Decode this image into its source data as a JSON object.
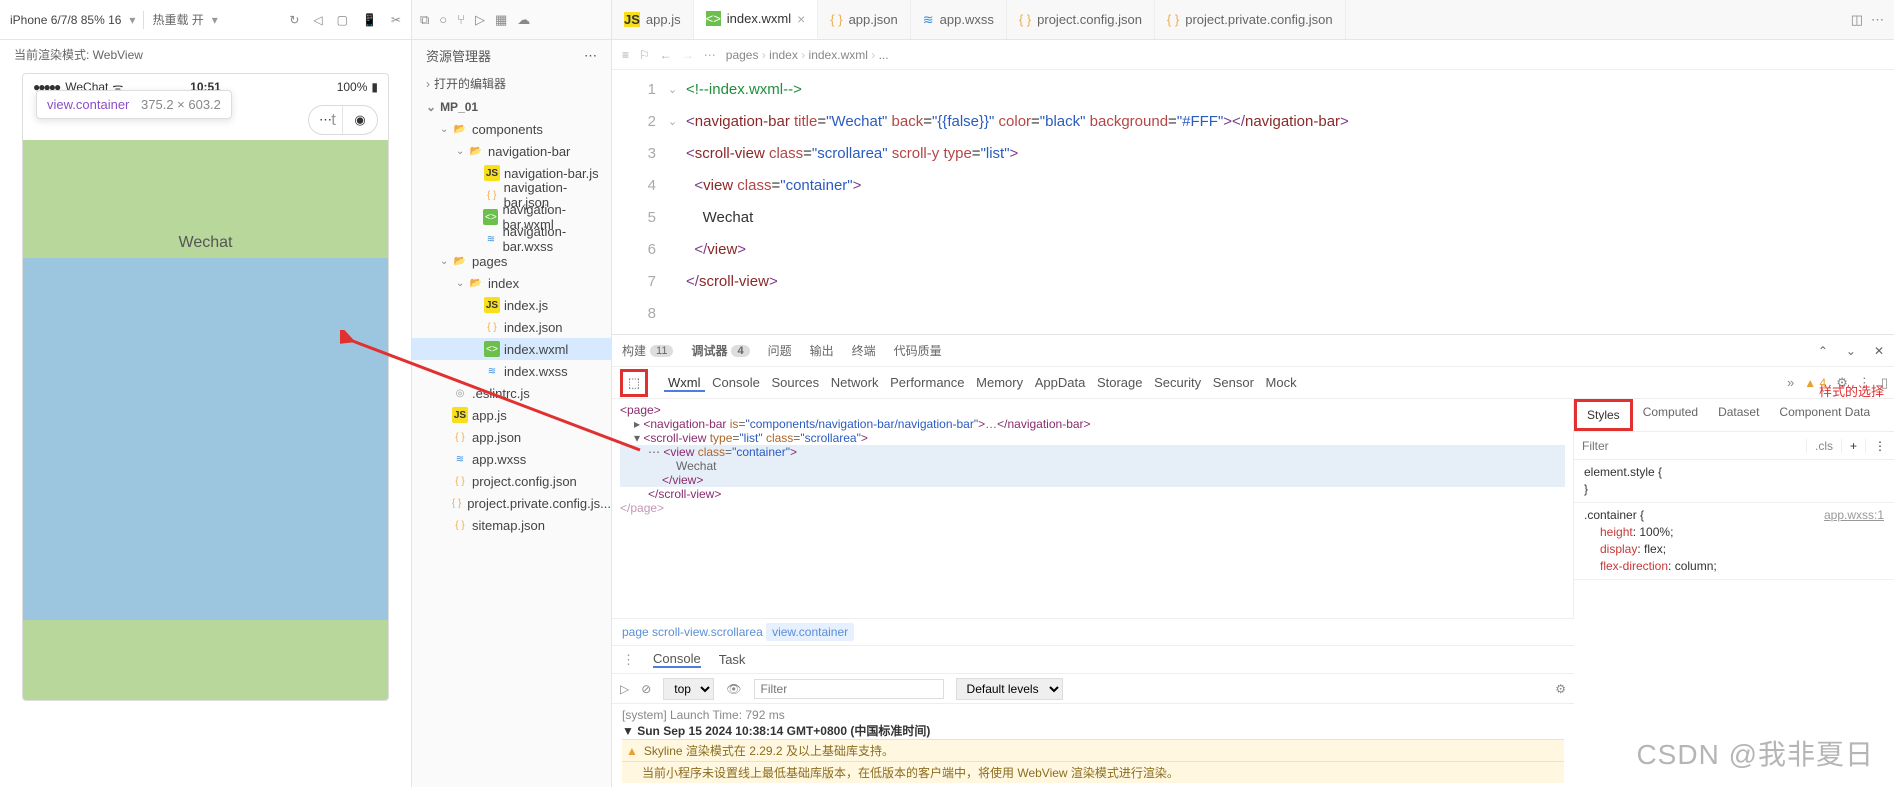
{
  "simulator": {
    "device": "iPhone 6/7/8 85% 16",
    "reload_label": "热重载 开",
    "mode_label": "当前渲染模式: WebView",
    "status": {
      "signal": "●●●●●",
      "carrier": "WeChat",
      "wifi": "⦿",
      "time": "10:51",
      "battery_pct": "100%"
    },
    "tooltip_tag": "view.container",
    "tooltip_dims": "375.2 × 603.2",
    "capsule_title": "t",
    "wechat_text": "Wechat"
  },
  "explorer": {
    "title": "资源管理器",
    "section_open_editors": "打开的编辑器",
    "project": "MP_01",
    "tree": [
      {
        "d": 1,
        "t": "folder-open",
        "n": "components",
        "exp": true
      },
      {
        "d": 2,
        "t": "folder-open",
        "n": "navigation-bar",
        "exp": true
      },
      {
        "d": 3,
        "t": "js",
        "n": "navigation-bar.js"
      },
      {
        "d": 3,
        "t": "json",
        "n": "navigation-bar.json"
      },
      {
        "d": 3,
        "t": "wxml",
        "n": "navigation-bar.wxml"
      },
      {
        "d": 3,
        "t": "wxss",
        "n": "navigation-bar.wxss"
      },
      {
        "d": 1,
        "t": "folder-open",
        "n": "pages",
        "exp": true
      },
      {
        "d": 2,
        "t": "folder-open",
        "n": "index",
        "exp": true
      },
      {
        "d": 3,
        "t": "js",
        "n": "index.js"
      },
      {
        "d": 3,
        "t": "json",
        "n": "index.json"
      },
      {
        "d": 3,
        "t": "wxml",
        "n": "index.wxml",
        "sel": true
      },
      {
        "d": 3,
        "t": "wxss",
        "n": "index.wxss"
      },
      {
        "d": 1,
        "t": "cfg",
        "n": ".eslintrc.js"
      },
      {
        "d": 1,
        "t": "js",
        "n": "app.js"
      },
      {
        "d": 1,
        "t": "json",
        "n": "app.json"
      },
      {
        "d": 1,
        "t": "wxss",
        "n": "app.wxss"
      },
      {
        "d": 1,
        "t": "json",
        "n": "project.config.json"
      },
      {
        "d": 1,
        "t": "json",
        "n": "project.private.config.js..."
      },
      {
        "d": 1,
        "t": "json",
        "n": "sitemap.json"
      }
    ]
  },
  "tabs": [
    {
      "icon": "js",
      "label": "app.js"
    },
    {
      "icon": "wxml",
      "label": "index.wxml",
      "active": true,
      "close": true
    },
    {
      "icon": "json",
      "label": "app.json"
    },
    {
      "icon": "wxss",
      "label": "app.wxss"
    },
    {
      "icon": "json",
      "label": "project.config.json"
    },
    {
      "icon": "json",
      "label": "project.private.config.json"
    }
  ],
  "breadcrumb": [
    "pages",
    "index",
    "index.wxml",
    "..."
  ],
  "code": {
    "lines": [
      {
        "n": 1,
        "html": "<span class='tok-comment'>&lt;!--index.wxml--&gt;</span>"
      },
      {
        "n": 2,
        "html": "<span class='tok-punc'>&lt;</span><span class='tok-tag'>navigation-bar</span> <span class='tok-attr'>title</span>=<span class='tok-val'>\"Wechat\"</span> <span class='tok-attr'>back</span>=<span class='tok-val'>\"{{false}}\"</span> <span class='tok-attr'>color</span>=<span class='tok-val'>\"black\"</span> <span class='tok-attr'>background</span>=<span class='tok-val'>\"#FFF\"</span><span class='tok-punc'>&gt;&lt;/</span><span class='tok-tag'>navigation-bar</span><span class='tok-punc'>&gt;</span>"
      },
      {
        "n": 3,
        "fold": true,
        "html": "<span class='tok-punc'>&lt;</span><span class='tok-tag'>scroll-view</span> <span class='tok-attr'>class</span>=<span class='tok-val'>\"scrollarea\"</span> <span class='tok-attr'>scroll-y</span> <span class='tok-attr'>type</span>=<span class='tok-val'>\"list\"</span><span class='tok-punc'>&gt;</span>"
      },
      {
        "n": 4,
        "fold": true,
        "html": "  <span class='tok-punc'>&lt;</span><span class='tok-tag'>view</span> <span class='tok-attr'>class</span>=<span class='tok-val'>\"container\"</span><span class='tok-punc'>&gt;</span>"
      },
      {
        "n": 5,
        "html": "    Wechat"
      },
      {
        "n": 6,
        "html": "  <span class='tok-punc'>&lt;/</span><span class='tok-tag'>view</span><span class='tok-punc'>&gt;</span>"
      },
      {
        "n": 7,
        "html": "<span class='tok-punc'>&lt;/</span><span class='tok-tag'>scroll-view</span><span class='tok-punc'>&gt;</span>"
      },
      {
        "n": 8,
        "html": ""
      }
    ]
  },
  "bottom_tabs": {
    "build": "构建",
    "build_count": "11",
    "debugger": "调试器",
    "debugger_count": "4",
    "problems": "问题",
    "output": "输出",
    "terminal": "终端",
    "quality": "代码质量"
  },
  "devtools_tabs": [
    "Wxml",
    "Console",
    "Sources",
    "Network",
    "Performance",
    "Memory",
    "AppData",
    "Storage",
    "Security",
    "Sensor",
    "Mock"
  ],
  "devtools_warn": "4",
  "wxml_tree": {
    "page_open": "<page>",
    "nav": "<navigation-bar is=\"components/navigation-bar/navigation-bar\">…</navigation-bar>",
    "sv_open": "<scroll-view type=\"list\" class=\"scrollarea\">",
    "view_open": "<view class=\"container\">",
    "view_text": "Wechat",
    "view_close": "</view>",
    "sv_close": "</scroll-view>",
    "page_close": "</page>"
  },
  "wxml_crumb": [
    "page",
    "scroll-view.scrollarea",
    "view.container"
  ],
  "styles": {
    "hint": "样式的选择",
    "tabs": [
      "Styles",
      "Computed",
      "Dataset",
      "Component Data"
    ],
    "filter_placeholder": "Filter",
    "cls": ".cls",
    "elem_style": "element.style {",
    "elem_close": "}",
    "container_sel": ".container {",
    "container_src": "app.wxss:1",
    "rules": [
      {
        "p": "height",
        "v": "100%;"
      },
      {
        "p": "display",
        "v": "flex;"
      },
      {
        "p": "flex-direction",
        "v": "column;"
      }
    ]
  },
  "console": {
    "tabs": [
      "Console",
      "Task"
    ],
    "top": "top",
    "filter_placeholder": "Filter",
    "levels": "Default levels",
    "launch": "[system] Launch Time: 792 ms",
    "date": "Sun Sep 15 2024 10:38:14 GMT+0800 (中国标准时间)",
    "warn1": "Skyline 渲染模式在 2.29.2 及以上基础库支持。",
    "warn2": "当前小程序未设置线上最低基础库版本，在低版本的客户端中，将使用 WebView 渲染模式进行渲染。"
  },
  "watermark": "CSDN @我非夏日"
}
